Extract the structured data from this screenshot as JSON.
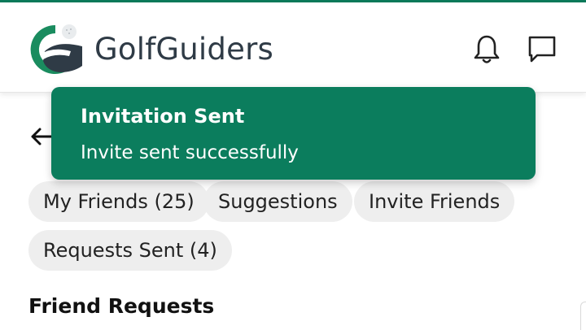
{
  "header": {
    "brand": "GolfGuiders",
    "notifications_icon": "bell-icon",
    "messages_icon": "chat-icon"
  },
  "colors": {
    "brand_green": "#0b7d5d",
    "chip_bg": "#eeeeee"
  },
  "nav": {
    "back_icon": "back-arrow-icon"
  },
  "tabs": [
    {
      "label": "My Friends (25)"
    },
    {
      "label": "Suggestions"
    },
    {
      "label": "Invite Friends"
    },
    {
      "label": "Requests Sent (4)"
    }
  ],
  "section": {
    "title": "Friend Requests"
  },
  "toast": {
    "title": "Invitation Sent",
    "message": "Invite sent successfully"
  }
}
